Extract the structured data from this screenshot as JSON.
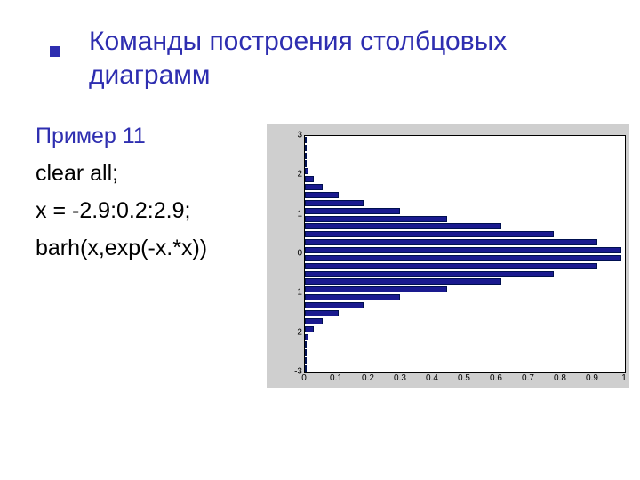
{
  "title": "Команды построения столбцовых диаграмм",
  "example_label": "Пример 11",
  "code": [
    "clear all;",
    "x = -2.9:0.2:2.9;",
    "barh(x,exp(-x.*x))"
  ],
  "chart_data": {
    "type": "barh",
    "categories": [
      -2.9,
      -2.7,
      -2.5,
      -2.3,
      -2.1,
      -1.9,
      -1.7,
      -1.5,
      -1.3,
      -1.1,
      -0.9,
      -0.7,
      -0.5,
      -0.3,
      -0.1,
      0.1,
      0.3,
      0.5,
      0.7,
      0.9,
      1.1,
      1.3,
      1.5,
      1.7,
      1.9,
      2.1,
      2.3,
      2.5,
      2.7,
      2.9
    ],
    "values": [
      0.0002,
      0.0007,
      0.0019,
      0.005,
      0.0122,
      0.0271,
      0.0556,
      0.1054,
      0.1845,
      0.2982,
      0.4449,
      0.6126,
      0.7788,
      0.9139,
      0.99,
      0.99,
      0.9139,
      0.7788,
      0.6126,
      0.4449,
      0.2982,
      0.1845,
      0.1054,
      0.0556,
      0.0271,
      0.0122,
      0.005,
      0.0019,
      0.0007,
      0.0002
    ],
    "xlim": [
      0,
      1
    ],
    "ylim": [
      -3,
      3
    ],
    "xticks": [
      0,
      0.1,
      0.2,
      0.3,
      0.4,
      0.5,
      0.6,
      0.7,
      0.8,
      0.9,
      1
    ],
    "yticks": [
      -3,
      -2,
      -1,
      0,
      1,
      2,
      3
    ],
    "bar_color": "#1a1a8f"
  }
}
